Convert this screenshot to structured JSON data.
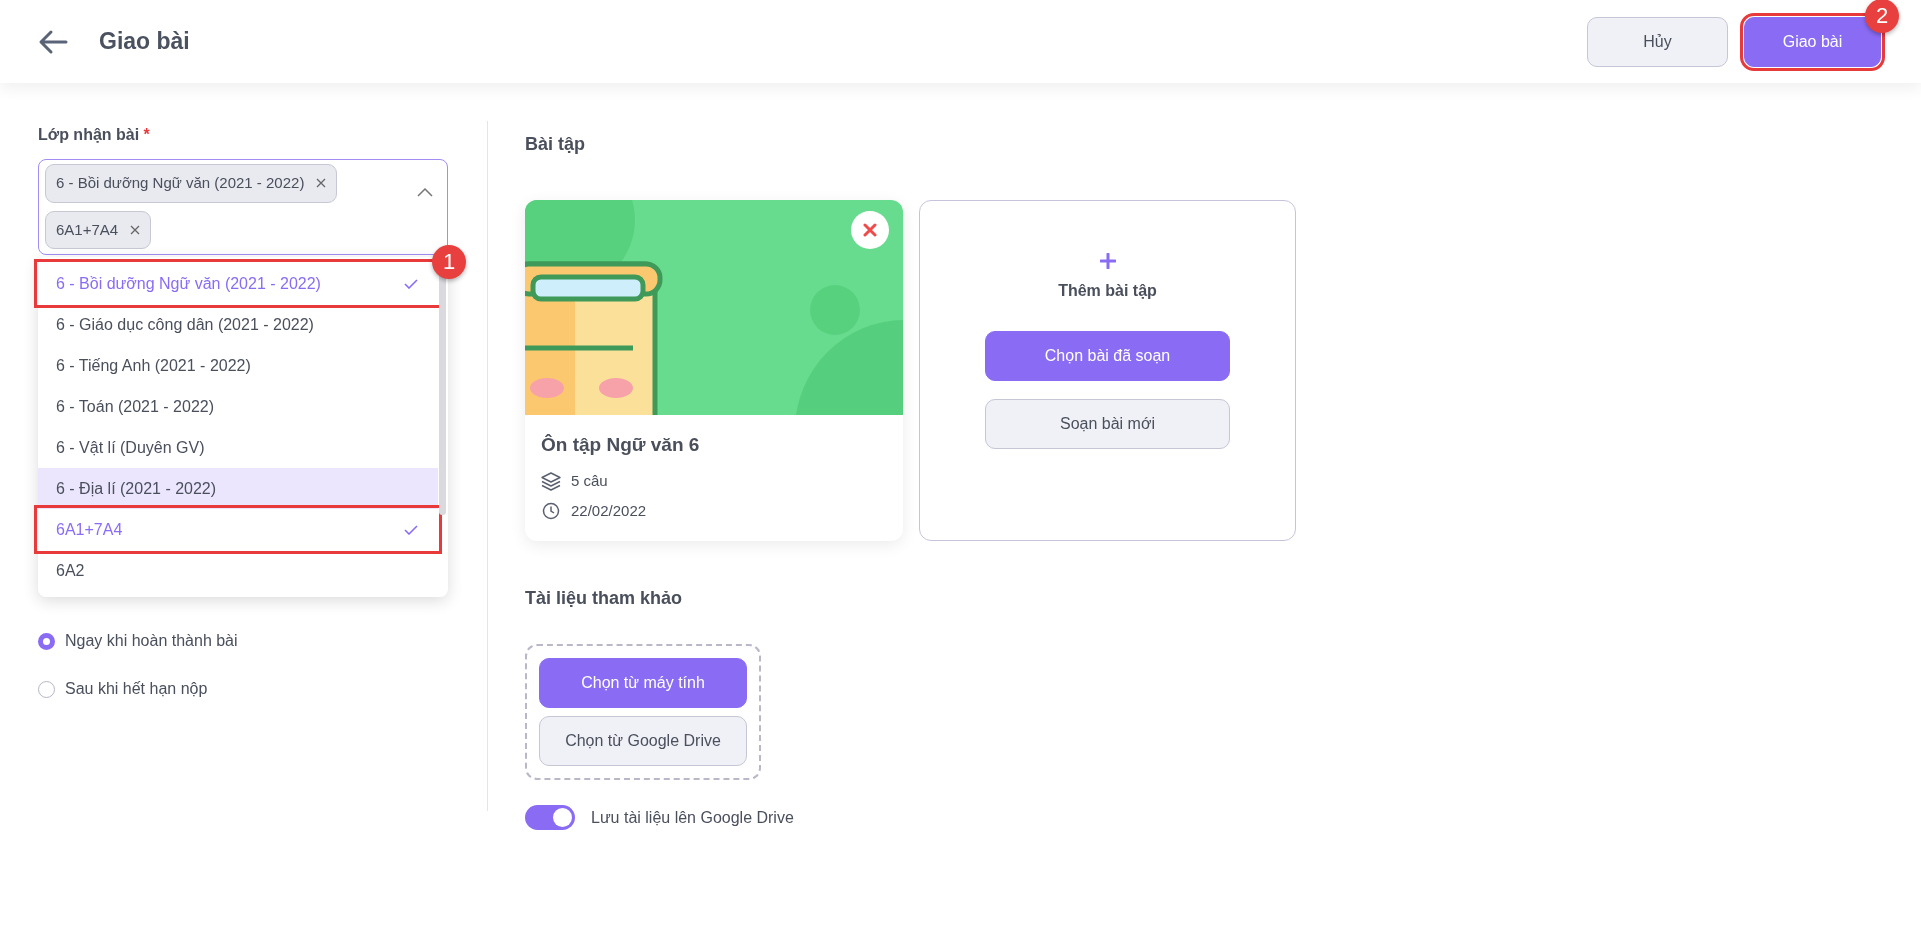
{
  "header": {
    "title": "Giao bài",
    "buttons": [
      {
        "label": "Hủy",
        "kind": "secondary",
        "outlined": false
      },
      {
        "label": "Giao bài",
        "kind": "primary",
        "outlined": true,
        "callout": "2"
      }
    ]
  },
  "class_field": {
    "label": "Lớp nhận bài",
    "required_mark": "*",
    "expanded": true,
    "tags": [
      "6 - Bồi dưỡng Ngữ văn (2021 - 2022)",
      "6A1+7A4"
    ],
    "options": [
      {
        "label": "6 - Bồi dưỡng Ngữ văn (2021 - 2022)",
        "selected": true,
        "hovered": false,
        "outlined": true,
        "callout": "1"
      },
      {
        "label": "6 - Giáo dục công dân (2021 - 2022)",
        "selected": false,
        "hovered": false,
        "outlined": false
      },
      {
        "label": "6 - Tiếng Anh (2021 - 2022)",
        "selected": false,
        "hovered": false,
        "outlined": false
      },
      {
        "label": "6 - Toán (2021 - 2022)",
        "selected": false,
        "hovered": false,
        "outlined": false
      },
      {
        "label": "6 - Vật lí (Duyên GV)",
        "selected": false,
        "hovered": false,
        "outlined": false
      },
      {
        "label": "6 - Địa lí (2021 - 2022)",
        "selected": false,
        "hovered": true,
        "outlined": false
      },
      {
        "label": "6A1+7A4",
        "selected": true,
        "hovered": false,
        "outlined": true
      },
      {
        "label": "6A2",
        "selected": false,
        "hovered": false,
        "outlined": false
      }
    ]
  },
  "answer_release": {
    "options": [
      {
        "label": "Ngay khi hoàn thành bài",
        "selected": true
      },
      {
        "label": "Sau khi hết hạn nộp",
        "selected": false
      }
    ]
  },
  "exercises": {
    "title": "Bài tập",
    "items": [
      {
        "title": "Ôn tập Ngữ văn 6",
        "count": "5 câu",
        "date": "22/02/2022"
      }
    ],
    "add_card": {
      "title": "Thêm bài tập",
      "buttons": [
        {
          "label": "Chọn bài đã soạn",
          "kind": "primary"
        },
        {
          "label": "Soạn bài mới",
          "kind": "secondary"
        }
      ]
    }
  },
  "references": {
    "title": "Tài liệu tham khảo",
    "buttons": [
      {
        "label": "Chọn từ máy tính",
        "kind": "primary"
      },
      {
        "label": "Chọn từ Google Drive",
        "kind": "secondary"
      }
    ],
    "save_toggle": {
      "label": "Lưu tài liệu lên Google Drive",
      "on": true
    }
  }
}
